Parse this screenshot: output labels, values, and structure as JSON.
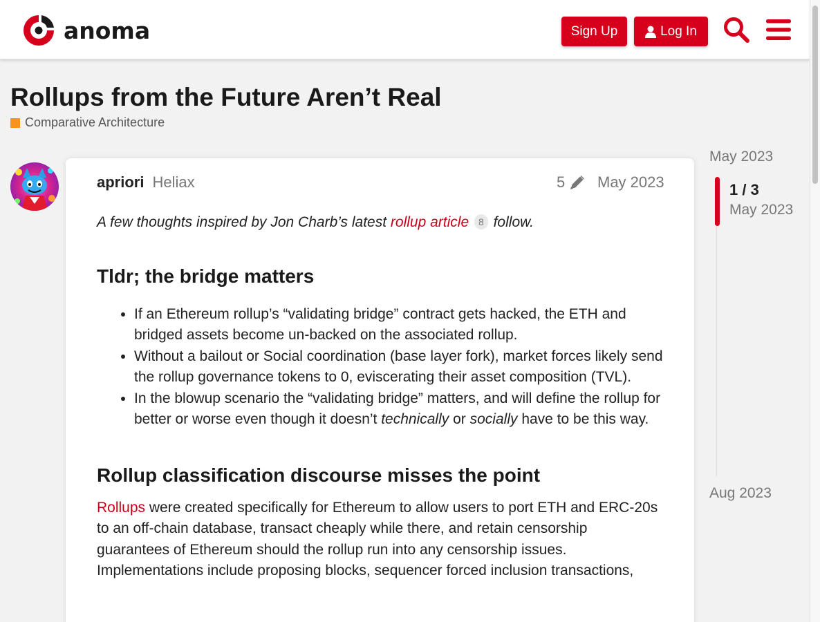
{
  "header": {
    "logo_text": "anoma",
    "signup_label": "Sign Up",
    "login_label": "Log In",
    "icons": [
      "anoma-logo-icon",
      "user-icon",
      "search-icon",
      "hamburger-menu-icon"
    ]
  },
  "topic": {
    "title": "Rollups from the Future Aren’t Real",
    "category": "Comparative Architecture",
    "category_color": "#f7941d"
  },
  "post": {
    "username": "apriori",
    "user_title": "Heliax",
    "edit_count": "5",
    "date": "May 2023",
    "intro_prefix": "A few thoughts inspired by Jon Charb’s latest ",
    "intro_link": "rollup article",
    "intro_link_count": "8",
    "intro_suffix": " follow.",
    "heading1": "Tldr; the bridge matters",
    "bullets": {
      "b1": "If an Ethereum rollup’s “validating bridge” contract gets hacked, the ETH and bridged assets become un-backed on the associated rollup.",
      "b2": "Without a bailout or Social coordination (base layer fork), market forces likely send the rollup governance tokens to 0, eviscerating their asset composition (TVL).",
      "b3_prefix": "In the blowup scenario the “validating bridge” matters, and will define the rollup for better or worse even though it doesn’t ",
      "b3_em1": "technically",
      "b3_mid": " or ",
      "b3_em2": "socially",
      "b3_suffix": " have to be this way."
    },
    "heading2": "Rollup classification discourse misses the point",
    "para_link": "Rollups",
    "para_text": " were created specifically for Ethereum to allow users to port ETH and ERC-20s to an off-chain database, transact cheaply while there, and retain censorship guarantees of Ethereum should the rollup run into any censorship issues. Implementations include proposing blocks, sequencer forced inclusion transactions,"
  },
  "timeline": {
    "start_date": "May 2023",
    "position": "1 / 3",
    "current_date": "May 2023",
    "end_date": "Aug 2023",
    "progress_fraction": 0.33
  },
  "colors": {
    "accent": "#d6001c",
    "link": "#c8001a",
    "category": "#f7941d"
  }
}
